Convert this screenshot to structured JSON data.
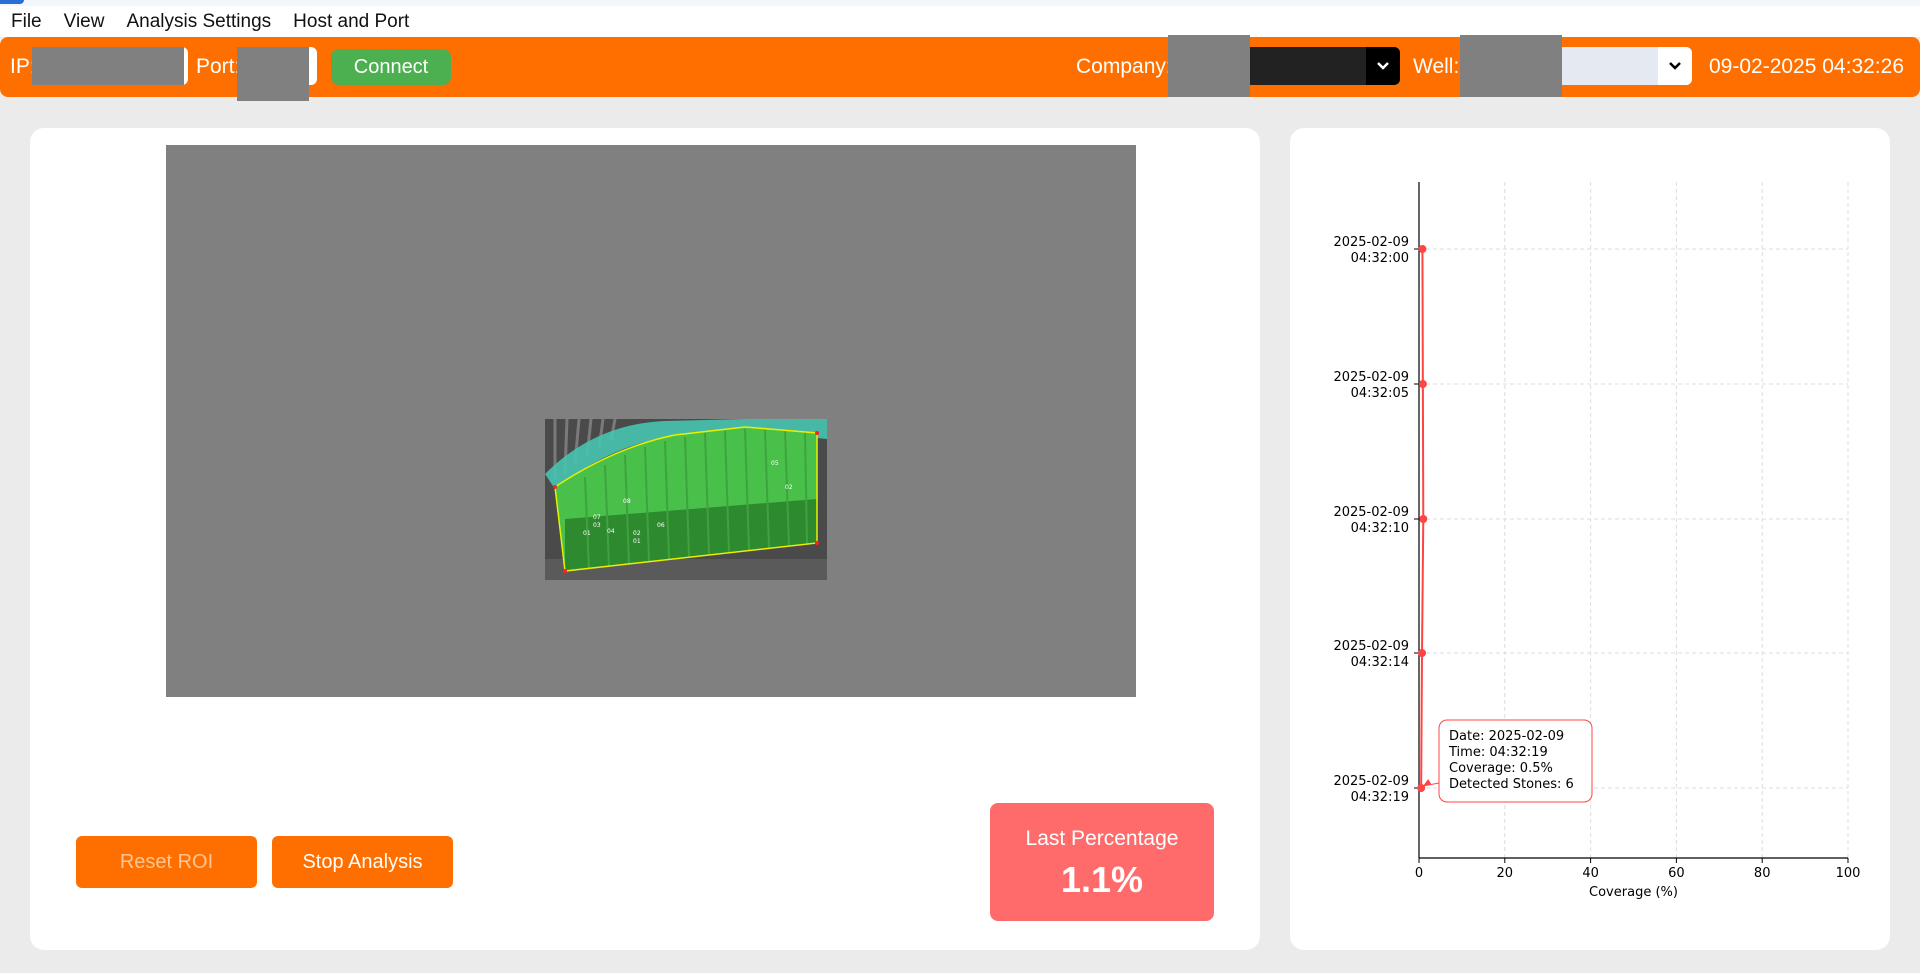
{
  "menu": [
    "File",
    "View",
    "Analysis Settings",
    "Host and Port"
  ],
  "toolbar": {
    "ip_label": "IP:",
    "port_label": "Port:",
    "connect_label": "Connect",
    "company_label": "Company:",
    "well_label": "Well:",
    "datetime": "09-02-2025 04:32:26"
  },
  "controls": {
    "reset_roi": "Reset ROI",
    "stop_analysis": "Stop Analysis"
  },
  "last_percentage": {
    "title": "Last Percentage",
    "value": "1.1%"
  },
  "chart_data": {
    "type": "line",
    "xlabel": "Coverage (%)",
    "xlim": [
      0,
      100
    ],
    "x_ticks": [
      0,
      20,
      40,
      60,
      80,
      100
    ],
    "y_ticks": [
      {
        "date": "2025-02-09",
        "time": "04:32:00"
      },
      {
        "date": "2025-02-09",
        "time": "04:32:05"
      },
      {
        "date": "2025-02-09",
        "time": "04:32:10"
      },
      {
        "date": "2025-02-09",
        "time": "04:32:14"
      },
      {
        "date": "2025-02-09",
        "time": "04:32:19"
      }
    ],
    "grid": true,
    "series": [
      {
        "color": "#ff4444",
        "points": [
          {
            "time": "2025-02-09 04:32:00",
            "coverage": 0.8
          },
          {
            "time": "2025-02-09 04:32:05",
            "coverage": 0.9
          },
          {
            "time": "2025-02-09 04:32:10",
            "coverage": 1.0
          },
          {
            "time": "2025-02-09 04:32:14",
            "coverage": 0.7
          },
          {
            "time": "2025-02-09 04:32:19",
            "coverage": 0.5
          }
        ]
      }
    ],
    "tooltip": {
      "lines": [
        "Date: 2025-02-09",
        "Time: 04:32:19",
        "Coverage: 0.5%",
        "Detected Stones: 6"
      ]
    }
  },
  "colors": {
    "accent": "#ff6f00",
    "connect": "#4caf50",
    "highlight": "#ff6b6b",
    "series": "#ff4444"
  }
}
